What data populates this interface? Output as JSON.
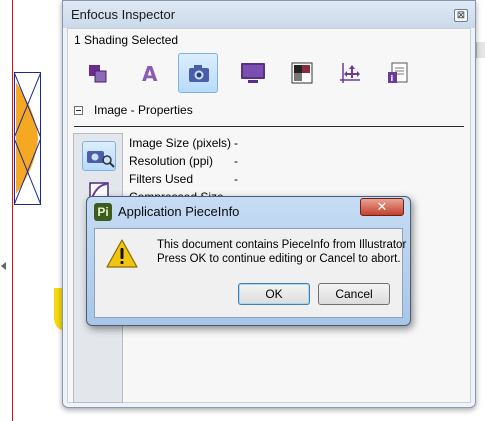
{
  "inspector": {
    "title": "Enfocus Inspector",
    "close_glyph": "⊠",
    "selection_text": "1 Shading Selected",
    "toolbar_icons": [
      "shape-icon",
      "text-icon",
      "image-icon",
      "monitor-icon",
      "color-swatch-icon",
      "transform-icon",
      "document-info-icon"
    ],
    "active_toolbar_icon": "image-icon",
    "section_title": "Image - Properties",
    "properties": [
      {
        "label": "Image Size (pixels)",
        "value": "-"
      },
      {
        "label": "Resolution (ppi)",
        "value": "-"
      },
      {
        "label": "Filters Used",
        "value": "-"
      },
      {
        "label": "Compressed Size",
        "value": ""
      }
    ]
  },
  "dialog": {
    "title": "Application PieceInfo",
    "app_icon_text": "Pi",
    "close_glyph": "✕",
    "message_line1": "This document contains PieceInfo from Illustrator",
    "message_line2": "Press OK to continue editing or Cancel to abort.",
    "ok_label": "OK",
    "cancel_label": "Cancel"
  },
  "colors": {
    "accent_yellow": "#f5d90e",
    "warning_yellow": "#f1c40f",
    "guide_red": "#dd1111",
    "active_tool_blue": "#b8dbfb"
  }
}
